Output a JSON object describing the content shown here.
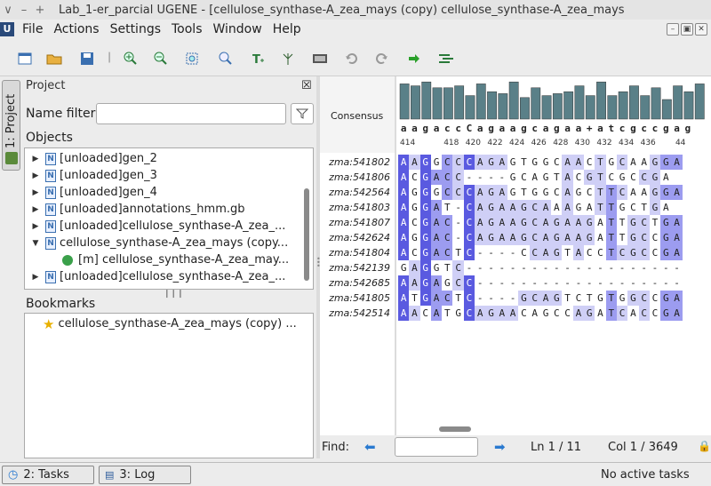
{
  "window": {
    "title": "Lab_1-er_parcial UGENE - [cellulose_synthase-A_zea_mays (copy) cellulose_synthase-A_zea_mays",
    "ctrl_chars": [
      "∨",
      "–",
      "+"
    ]
  },
  "menu": {
    "logo": "U",
    "items": [
      "File",
      "Actions",
      "Settings",
      "Tools",
      "Window",
      "Help"
    ]
  },
  "sidetab": {
    "label": "1: Project"
  },
  "project": {
    "title": "Project",
    "close_glyph": "☒",
    "name_filter_label": "Name filter",
    "name_filter_value": "",
    "objects_label": "Objects",
    "tree": [
      {
        "label": "[unloaded]gen_2",
        "expanded": false,
        "indent": 0
      },
      {
        "label": "[unloaded]gen_3",
        "expanded": false,
        "indent": 0
      },
      {
        "label": "[unloaded]gen_4",
        "expanded": false,
        "indent": 0
      },
      {
        "label": "[unloaded]annotations_hmm.gb",
        "expanded": false,
        "indent": 0
      },
      {
        "label": "[unloaded]cellulose_synthase-A_zea_...",
        "expanded": false,
        "indent": 0
      },
      {
        "label": "cellulose_synthase-A_zea_mays (copy...",
        "expanded": true,
        "indent": 0
      },
      {
        "label": "[m] cellulose_synthase-A_zea_may...",
        "expanded": false,
        "indent": 1
      },
      {
        "label": "[unloaded]cellulose_synthase-A_zea_...",
        "expanded": false,
        "indent": 0
      }
    ],
    "bookmarks_label": "Bookmarks",
    "bookmarks": [
      "cellulose_synthase-A_zea_mays (copy) ..."
    ]
  },
  "alignment": {
    "consensus_label": "Consensus",
    "consensus_seq": "aagaccCagaagcagaa+atcgccgag",
    "ruler": [
      "414",
      "418",
      "420",
      "422",
      "424",
      "426",
      "428",
      "430",
      "432",
      "434",
      "436",
      "44"
    ],
    "sequences": [
      {
        "name": "zma:541802",
        "seq": "AAGGCCCAGAGTGGCAACTGCAAGGA"
      },
      {
        "name": "zma:541806",
        "seq": "ACGACC----GCAGTACGTCGCCGA"
      },
      {
        "name": "zma:542564",
        "seq": "AGGGCCCAGAGTGGCAGCTTCAAGGA"
      },
      {
        "name": "zma:541803",
        "seq": "AGGAT-CAGAAGCAAAGATTGCTGA"
      },
      {
        "name": "zma:541807",
        "seq": "ACGAC-CAGAAGCAGAAGATTGCTGA"
      },
      {
        "name": "zma:542624",
        "seq": "AGGAC-CAGAAGCAGAAGATTGCCGA"
      },
      {
        "name": "zma:541804",
        "seq": "ACGACTC----CCAGTACCTCGCCGA"
      },
      {
        "name": "zma:542139",
        "seq": "GAGGTC--------------------"
      },
      {
        "name": "zma:542685",
        "seq": "AAGAGCC-------------------"
      },
      {
        "name": "zma:541805",
        "seq": "ATGACTC----GCAGTCTGTGGCCGA"
      },
      {
        "name": "zma:542514",
        "seq": "AACATGCAGAACAGCCAGATCACCGA"
      }
    ],
    "consensus_histogram": [
      0.9,
      0.85,
      0.95,
      0.8,
      0.8,
      0.85,
      0.6,
      0.9,
      0.7,
      0.65,
      0.95,
      0.55,
      0.8,
      0.6,
      0.65,
      0.7,
      0.85,
      0.6,
      0.95,
      0.6,
      0.7,
      0.85,
      0.6,
      0.8,
      0.5,
      0.85,
      0.7,
      0.9
    ]
  },
  "find": {
    "label": "Find:",
    "value": "",
    "line": "Ln 1 / 11",
    "col": "Col 1 / 3649"
  },
  "status": {
    "tasks_tab": "2: Tasks",
    "log_tab": "3: Log",
    "tasks_text": "No active tasks"
  },
  "colors": {
    "strong": "#5a5ae0",
    "mid": "#9c9cf0",
    "light": "#cfcff6",
    "bar": "#5a8088"
  }
}
